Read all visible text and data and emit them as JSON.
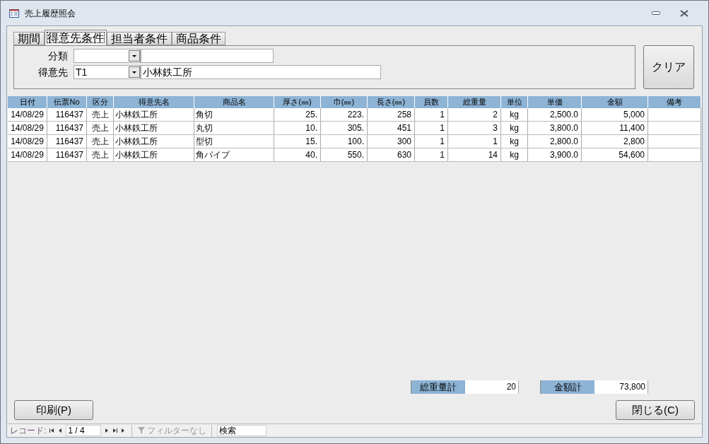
{
  "window": {
    "title": "売上履歴照会"
  },
  "tabs": [
    {
      "label": "期間",
      "selected": false
    },
    {
      "label": "得意先条件",
      "selected": true
    },
    {
      "label": "担当者条件",
      "selected": false
    },
    {
      "label": "商品条件",
      "selected": false
    }
  ],
  "filters": [
    {
      "label": "分類"
    },
    {
      "label": "得意先",
      "code": "T1",
      "name": "小林鉄工所"
    }
  ],
  "clear_button": "クリア",
  "table": {
    "columns": [
      "日付",
      "伝票No",
      "区分",
      "得意先名",
      "商品名",
      "厚さ(㎜)",
      "巾(㎜)",
      "長さ(㎜)",
      "員数",
      "総重量",
      "単位",
      "単価",
      "金額",
      "備考"
    ],
    "rows": [
      [
        "14/08/29",
        "116437",
        "売上",
        "小林鉄工所",
        "角切",
        "25.",
        "223.",
        "258",
        "1",
        "2",
        "kg",
        "2,500.0",
        "5,000",
        ""
      ],
      [
        "14/08/29",
        "116437",
        "売上",
        "小林鉄工所",
        "丸切",
        "10.",
        "305.",
        "451",
        "1",
        "3",
        "kg",
        "3,800.0",
        "11,400",
        ""
      ],
      [
        "14/08/29",
        "116437",
        "売上",
        "小林鉄工所",
        "型切",
        "15.",
        "100.",
        "300",
        "1",
        "1",
        "kg",
        "2,800.0",
        "2,800",
        ""
      ],
      [
        "14/08/29",
        "116437",
        "売上",
        "小林鉄工所",
        "角パイプ",
        "40.",
        "550.",
        "630",
        "1",
        "14",
        "kg",
        "3,900.0",
        "54,600",
        ""
      ]
    ]
  },
  "totals": [
    {
      "label": "総重量計",
      "value": "20"
    },
    {
      "label": "金額計",
      "value": "73,800"
    }
  ],
  "print_button": "印刷(P)",
  "close_button": "閉じる(C)",
  "navigation": {
    "label": "レコード:",
    "position": "1 / 4",
    "filter": {
      "label": "フィルターなし",
      "disabled": true
    },
    "search": {
      "placeholder": "検索"
    }
  }
}
